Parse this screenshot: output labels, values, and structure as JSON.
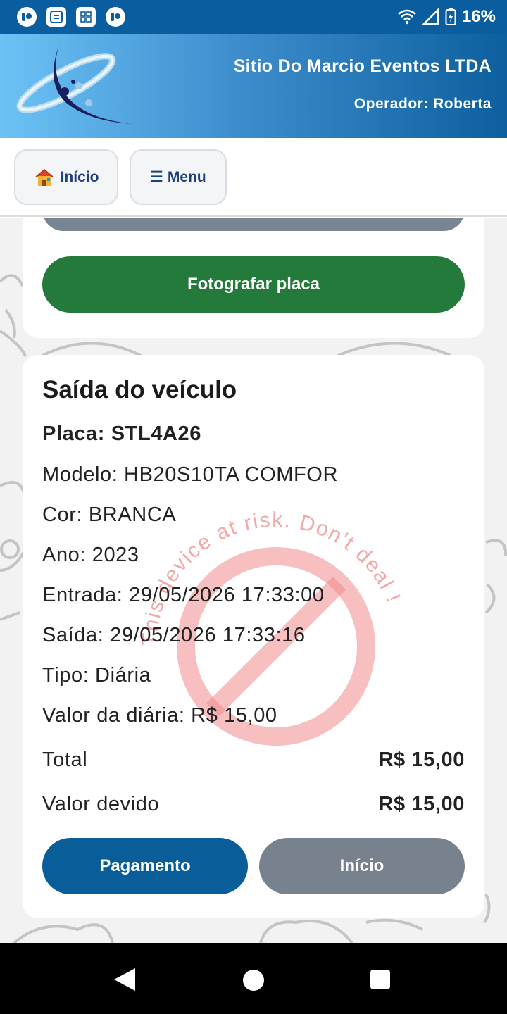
{
  "status_bar": {
    "battery_percent": "16%",
    "left_icons": [
      "app-notification-icon",
      "sync-app-icon",
      "grid-app-icon",
      "app-notification-icon"
    ],
    "right_icons": [
      "wifi-icon",
      "signal-icon",
      "battery-charging-icon"
    ]
  },
  "header": {
    "company": "Sitio Do Marcio Eventos LTDA",
    "operator": "Operador: Roberta"
  },
  "nav": {
    "home_label": "Início",
    "menu_label": "☰ Menu"
  },
  "photo_card": {
    "button_label": "Fotografar placa"
  },
  "exit_card": {
    "title": "Saída do veículo",
    "plate": "Placa: STL4A26",
    "model": "Modelo: HB20S10TA COMFOR",
    "color": "Cor: BRANCA",
    "year": "Ano: 2023",
    "entry": "Entrada: 29/05/2026 17:33:00",
    "exit": "Saída: 29/05/2026 17:33:16",
    "type": "Tipo: Diária",
    "daily_value": "Valor da diária: R$ 15,00",
    "total_label": "Total",
    "total_value": "R$ 15,00",
    "due_label": "Valor devido",
    "due_value": "R$ 15,00",
    "pay_button": "Pagamento",
    "home_button": "Início"
  },
  "watermark": {
    "text": "This device at risk. Don't deal !"
  },
  "colors": {
    "status_bar": "#0a5ea0",
    "photo_button": "#237a3a",
    "pay_button": "#095d99",
    "secondary_button": "#78828f",
    "watermark": "#e63333"
  }
}
